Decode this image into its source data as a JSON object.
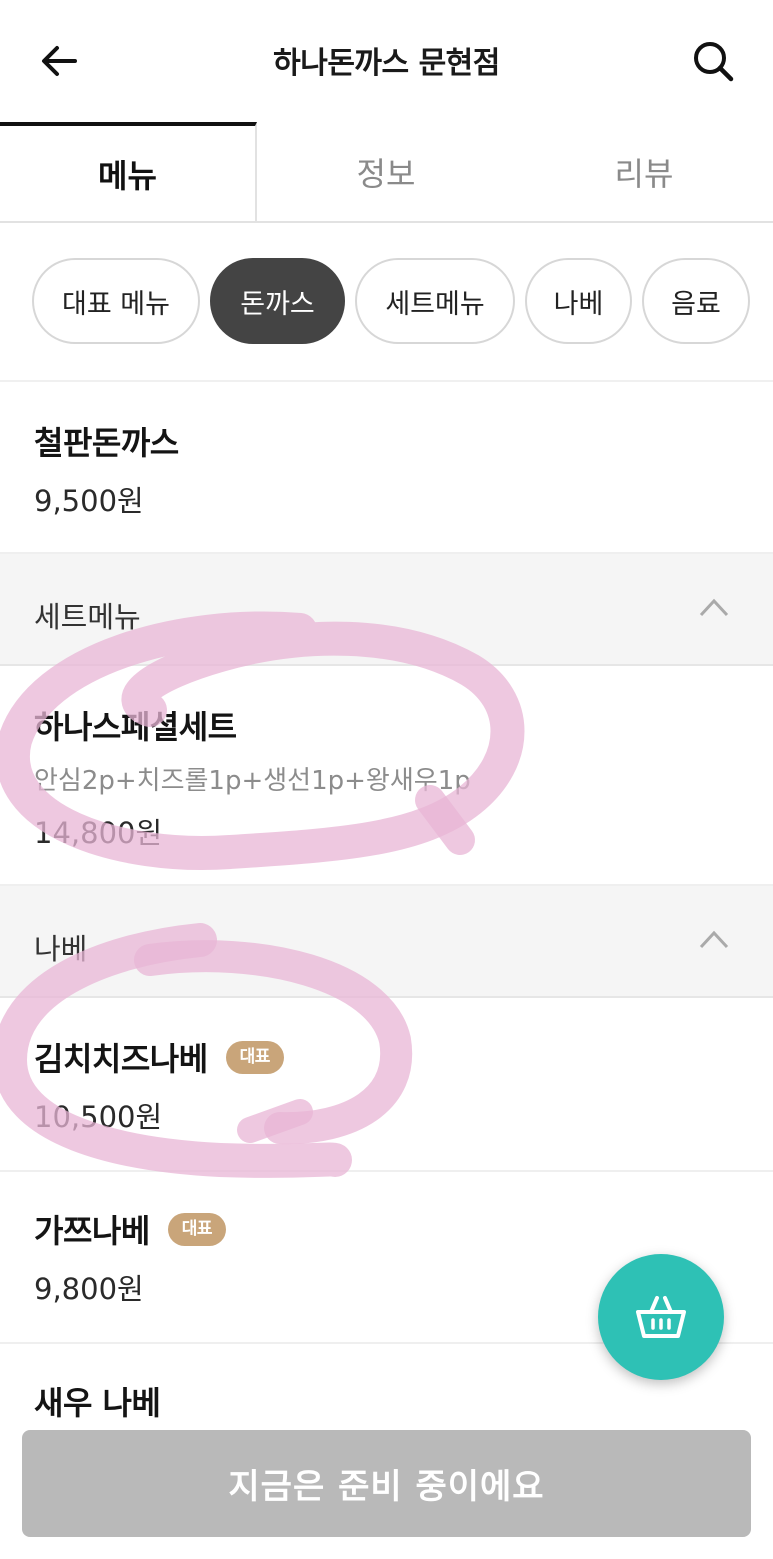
{
  "header": {
    "title": "하나돈까스 문현점",
    "back_icon": "arrow-left-icon",
    "search_icon": "search-icon"
  },
  "tabs": [
    {
      "label": "메뉴",
      "active": true
    },
    {
      "label": "정보",
      "active": false
    },
    {
      "label": "리뷰",
      "active": false
    }
  ],
  "categories": [
    {
      "label": "대표 메뉴",
      "active": false
    },
    {
      "label": "돈까스",
      "active": true
    },
    {
      "label": "세트메뉴",
      "active": false
    },
    {
      "label": "나베",
      "active": false
    },
    {
      "label": "음료",
      "active": false
    }
  ],
  "items": {
    "cheolpan": {
      "name": "철판돈까스",
      "price": "9,500원"
    },
    "hana_special": {
      "name": "하나스페셜세트",
      "desc": "안심2p+치즈롤1p+생선1p+왕새우1p",
      "price": "14,800원"
    },
    "kimchi_cheese": {
      "name": "김치치즈나베",
      "badge": "대표",
      "price": "10,500원"
    },
    "gazz": {
      "name": "가쯔나베",
      "badge": "대표",
      "price": "9,800원"
    },
    "shrimp": {
      "name": "새우 나베"
    }
  },
  "sections": {
    "set": {
      "title": "세트메뉴"
    },
    "nabe": {
      "title": "나베"
    }
  },
  "fab": {
    "icon": "basket-icon",
    "color": "#2ec1b5"
  },
  "cta": {
    "label": "지금은 준비 중이에요"
  },
  "colors": {
    "badge": "#c9a57a",
    "chip_active": "#444444",
    "cta_disabled": "#b9b9b9",
    "scribble": "#e8b6d6"
  }
}
